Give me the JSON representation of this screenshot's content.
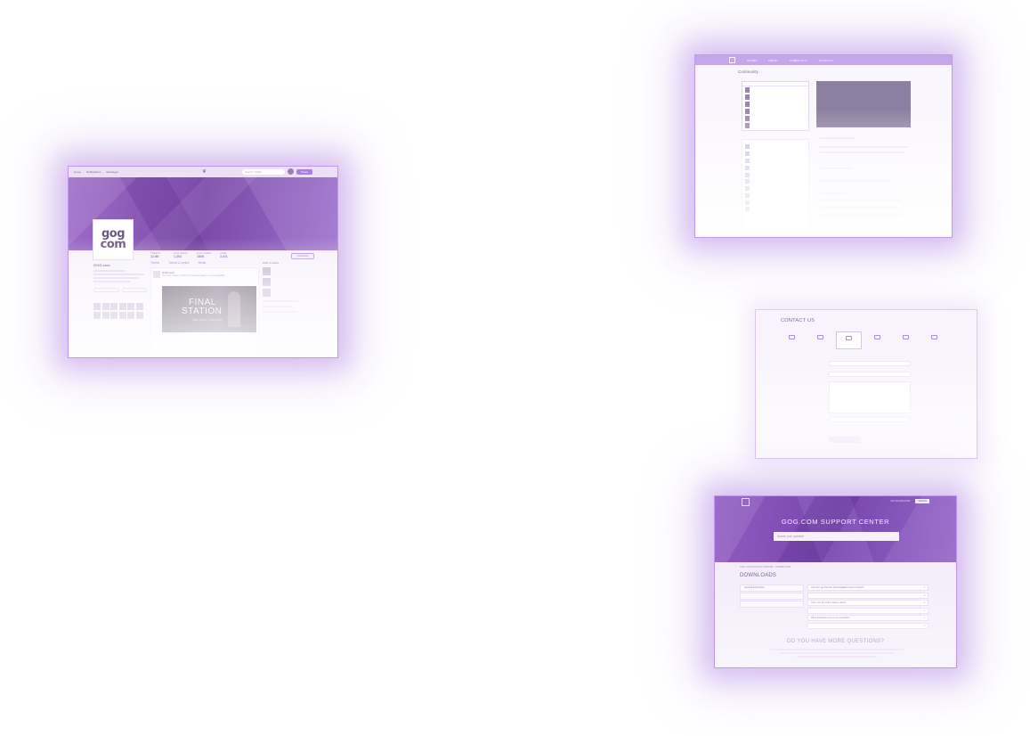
{
  "twitter": {
    "nav": [
      "Home",
      "Notifications",
      "Messages"
    ],
    "search_placeholder": "Search Twitter",
    "tweet_button": "Tweet",
    "logo_line1": "gog",
    "logo_line2": "com",
    "stats": [
      {
        "label": "TWEETS",
        "value": "13.8K"
      },
      {
        "label": "FOLLOWING",
        "value": "1,364"
      },
      {
        "label": "FOLLOWERS",
        "value": "186K"
      },
      {
        "label": "LIKES",
        "value": "3,411"
      }
    ],
    "follow_button": "Following",
    "profile_name": "GOG.com",
    "tabs": [
      "Tweets",
      "Tweets & replies",
      "Media"
    ],
    "tweet_author": "GOG.com",
    "tweet_text": "The Only Traitor, a DLC of The Final Station, is now available.",
    "media_line1": "FINAL",
    "media_line2": "STATION",
    "media_line3": "THE ONLY TRAITOR",
    "who_to_follow": "Who to follow"
  },
  "community": {
    "nav": [
      "STORE",
      "ABOUT",
      "COMMUNITY",
      "SUPPORT"
    ],
    "title": "Community"
  },
  "contact": {
    "title": "CONTACT US"
  },
  "support": {
    "nav_links": [
      "GO TO GOG.COM",
      "SIGN IN"
    ],
    "hero_title": "GOG.COM SUPPORT CENTER",
    "search_placeholder": "Search your question",
    "breadcrumb": "GOG.COM SUPPORT CENTER > DOWNLOADS",
    "page_title": "DOWNLOADS",
    "sidebar": [
      "General information"
    ],
    "faqs": [
      "How do I get the free downloadable bonus content?",
      "Can I use the GOG Galaxy client?",
      "What download options are available?"
    ],
    "more_title": "DO YOU HAVE MORE QUESTIONS?"
  }
}
